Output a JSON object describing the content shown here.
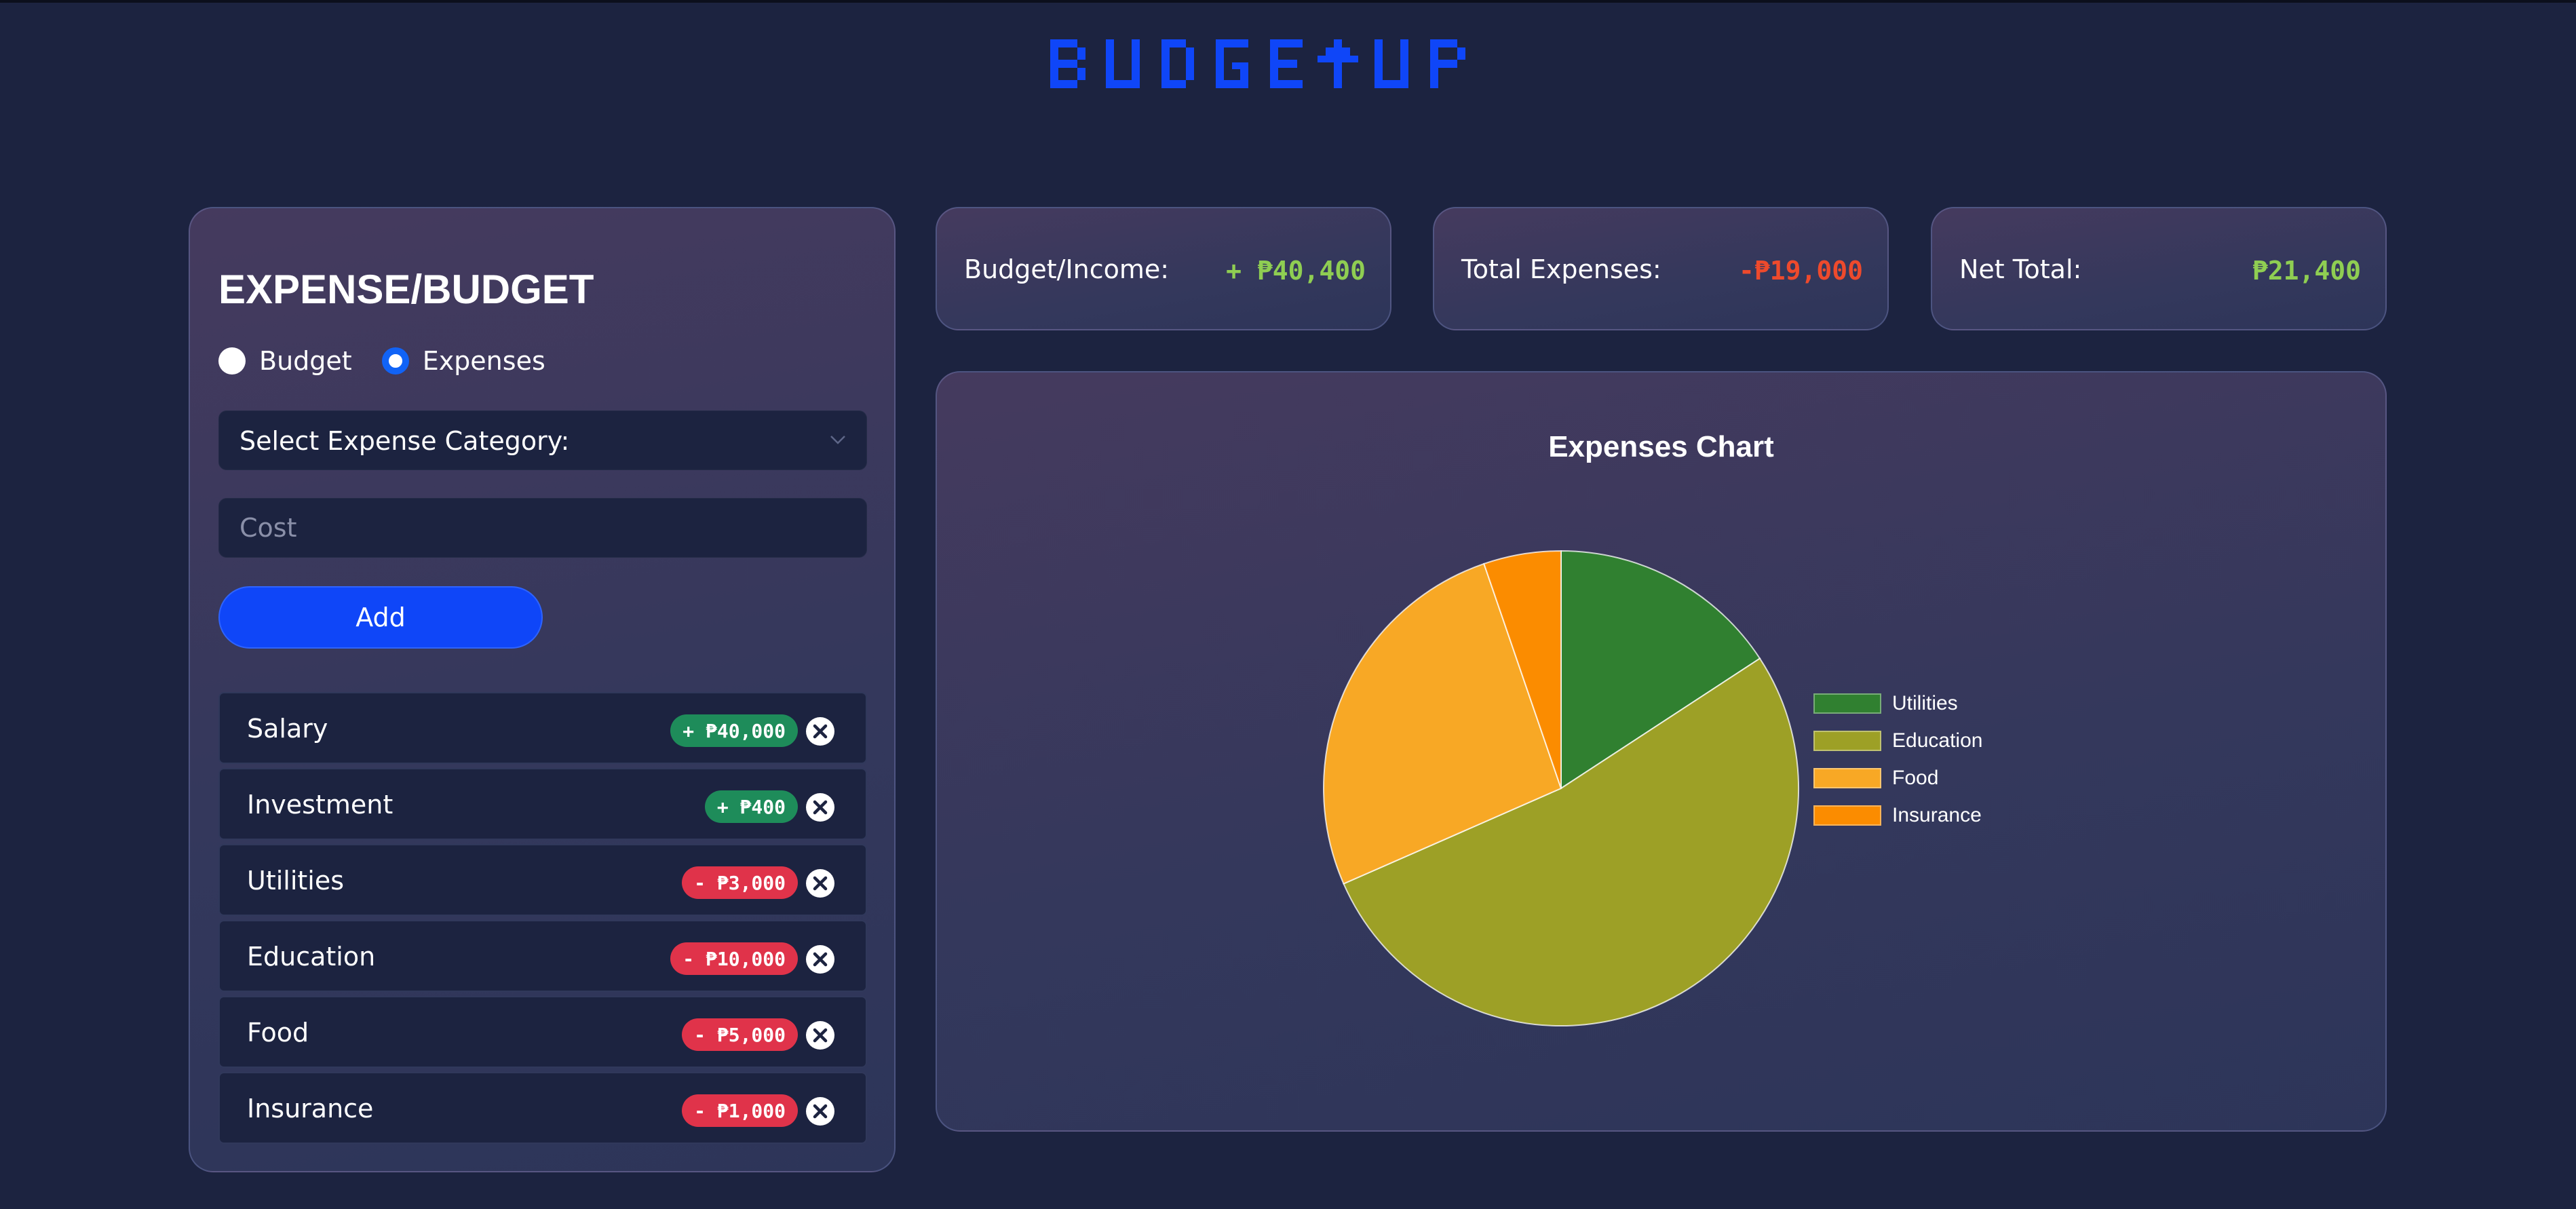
{
  "app": {
    "logo_text": "BUDGET↑UP"
  },
  "colors": {
    "background": "#1c2340",
    "accent": "#0f46f8",
    "income_pill": "#1e8c5a",
    "expense_pill": "#e0334a",
    "positive_value": "#8fce52",
    "negative_value": "#ee4a2c"
  },
  "form": {
    "title": "EXPENSE/BUDGET",
    "radio_budget": "Budget",
    "radio_expenses": "Expenses",
    "selected_type": "Expenses",
    "category_label": "Select Expense Category:",
    "cost_placeholder": "Cost",
    "add_label": "Add"
  },
  "entries": [
    {
      "label": "Salary",
      "amount": "+ ₱40,000",
      "kind": "income"
    },
    {
      "label": "Investment",
      "amount": "+ ₱400",
      "kind": "income"
    },
    {
      "label": "Utilities",
      "amount": "- ₱3,000",
      "kind": "expense"
    },
    {
      "label": "Education",
      "amount": "- ₱10,000",
      "kind": "expense"
    },
    {
      "label": "Food",
      "amount": "- ₱5,000",
      "kind": "expense"
    },
    {
      "label": "Insurance",
      "amount": "- ₱1,000",
      "kind": "expense"
    }
  ],
  "summary": {
    "income_label": "Budget/Income:",
    "income_value": "+ ₱40,400",
    "expenses_label": "Total Expenses:",
    "expenses_value": "-₱19,000",
    "net_label": "Net Total:",
    "net_value": "₱21,400"
  },
  "chart_data": {
    "type": "pie",
    "title": "Expenses Chart",
    "categories": [
      "Utilities",
      "Education",
      "Food",
      "Insurance"
    ],
    "values": [
      3000,
      10000,
      5000,
      1000
    ],
    "colors": [
      "#308030",
      "#9da026",
      "#f8a825",
      "#fb8c00"
    ],
    "legend": "right"
  }
}
